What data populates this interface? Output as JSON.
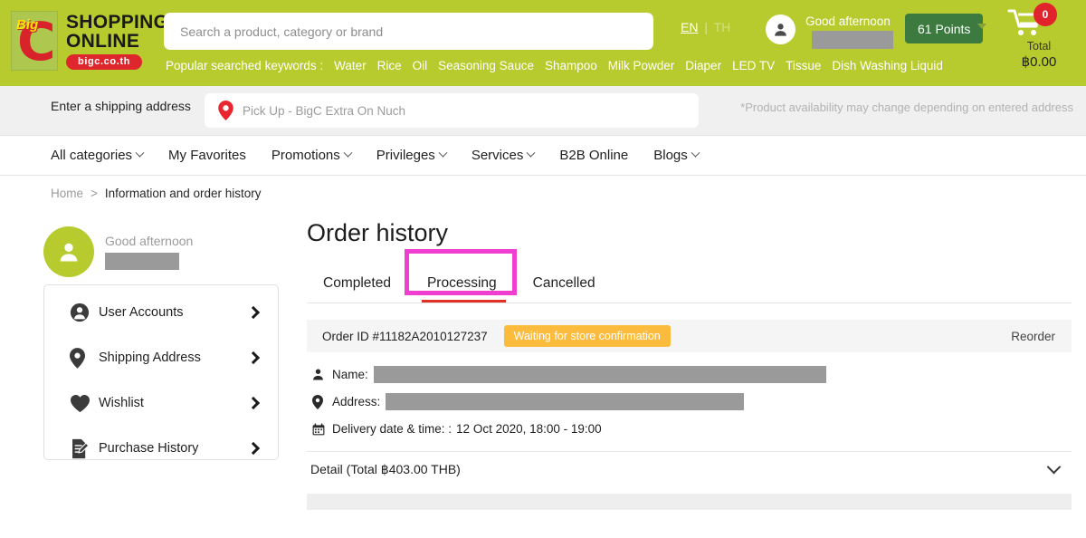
{
  "header": {
    "logo": {
      "big": "Big",
      "c": "C",
      "line1": "SHOPPING",
      "line2": "ONLINE",
      "pill": "bigc.co.th"
    },
    "search": {
      "placeholder": "Search a product, category or brand",
      "value": ""
    },
    "keywords_label": "Popular searched keywords :",
    "keywords": [
      "Water",
      "Rice",
      "Oil",
      "Seasoning Sauce",
      "Shampoo",
      "Milk Powder",
      "Diaper",
      "LED TV",
      "Tissue",
      "Dish Washing Liquid"
    ],
    "lang": {
      "active": "EN",
      "separator": "|",
      "inactive": "TH"
    },
    "account": {
      "icon": "user-icon",
      "greeting": "Good afternoon",
      "name_redacted": ""
    },
    "points_button": "61 Points",
    "cart": {
      "icon": "cart-icon",
      "badge": "0",
      "total_label": "Total",
      "total_value": "฿0.00"
    },
    "colors": {
      "band": "#b7cb2e",
      "points_button": "#3c7a3f",
      "cart_badge": "#e1232c"
    }
  },
  "shipping": {
    "label": "Enter a shipping address",
    "pin_icon": "map-pin-icon",
    "value": "Pick Up - BigC Extra On Nuch",
    "note": "*Product availability may change depending on entered address"
  },
  "nav": [
    {
      "label": "All categories",
      "caret": true
    },
    {
      "label": "My Favorites",
      "caret": false
    },
    {
      "label": "Promotions",
      "caret": true
    },
    {
      "label": "Privileges",
      "caret": true
    },
    {
      "label": "Services",
      "caret": true
    },
    {
      "label": "B2B Online",
      "caret": false
    },
    {
      "label": "Blogs",
      "caret": true
    }
  ],
  "breadcrumb": {
    "home": "Home",
    "separator": ">",
    "current": "Information and order history"
  },
  "sidebar": {
    "avatar_icon": "user-icon",
    "greeting": "Good afternoon",
    "name_redacted": "",
    "items": [
      {
        "label": "User Accounts",
        "icon": "user-circle-icon"
      },
      {
        "label": "Shipping Address",
        "icon": "map-pin-icon"
      },
      {
        "label": "Wishlist",
        "icon": "heart-icon"
      },
      {
        "label": "Purchase History",
        "icon": "document-edit-icon"
      }
    ]
  },
  "main": {
    "title": "Order history",
    "tabs": [
      {
        "label": "Completed",
        "active": false
      },
      {
        "label": "Processing",
        "active": true
      },
      {
        "label": "Cancelled",
        "active": false
      }
    ],
    "highlight_color": "#f03fd0",
    "order": {
      "order_id": "Order ID #11182A2010127237",
      "status": "Waiting for store confirmation",
      "status_color": "#fbbc3e",
      "reorder": "Reorder",
      "name_label": "Name:",
      "name_value_redacted": "",
      "address_label": "Address:",
      "address_value_redacted": "",
      "delivery_label": "Delivery date & time: :",
      "delivery_value": "12 Oct 2020, 18:00 - 19:00",
      "detail_label": "Detail (Total ฿403.00 THB)"
    }
  }
}
